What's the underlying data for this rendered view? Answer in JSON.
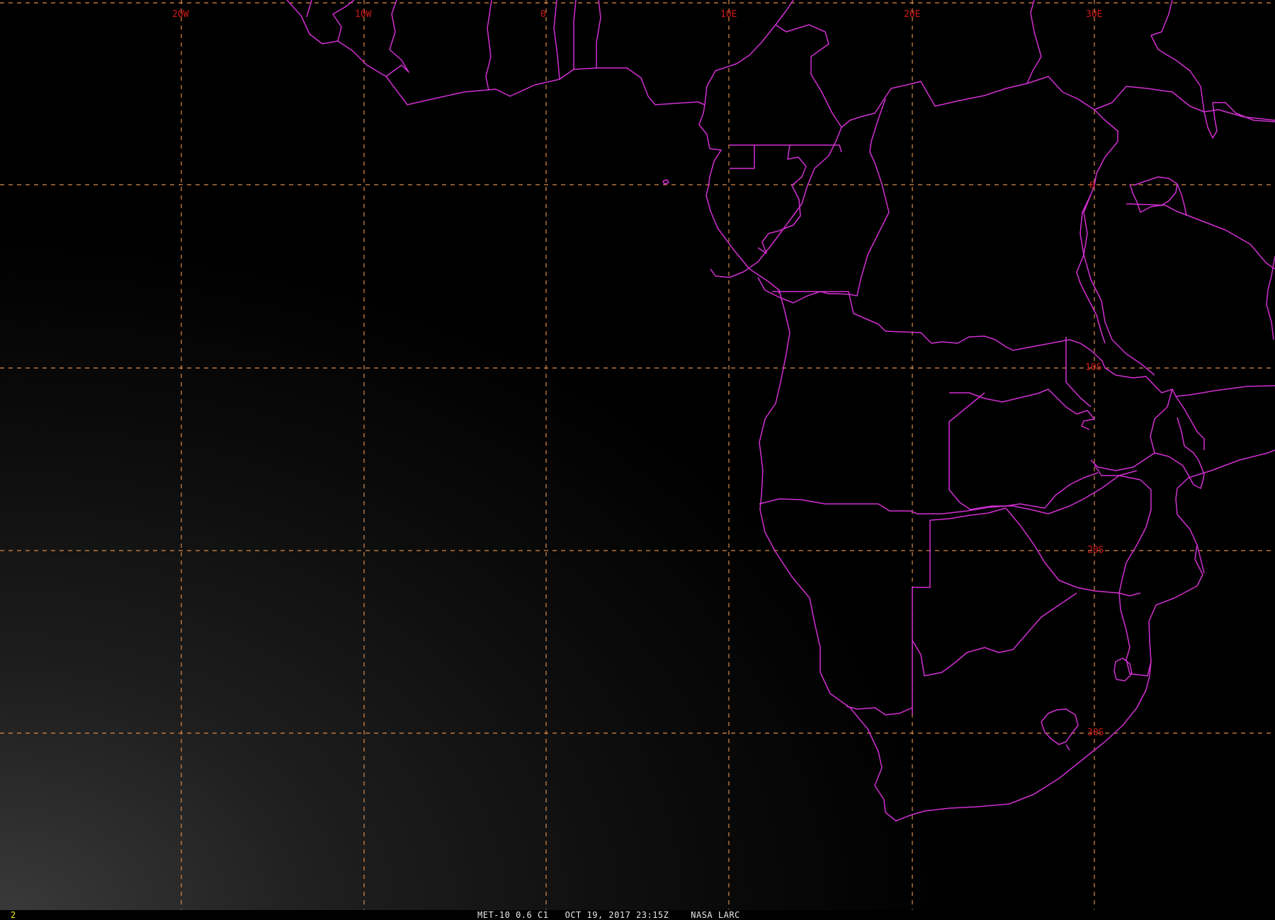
{
  "map": {
    "longitude_labels": [
      "20W",
      "10W",
      "0",
      "10E",
      "20E",
      "30E"
    ],
    "latitude_labels": [
      "0",
      "10S",
      "20S",
      "30S"
    ],
    "colors": {
      "background": "#000000",
      "grid": "#d98a4a",
      "borders": "#d22fd2",
      "labels": "#d01818"
    }
  },
  "status_bar": {
    "frame_number": "2",
    "caption": "MET-10 0.6 C1   OCT 19, 2017 23:15Z    NASA LARC"
  }
}
